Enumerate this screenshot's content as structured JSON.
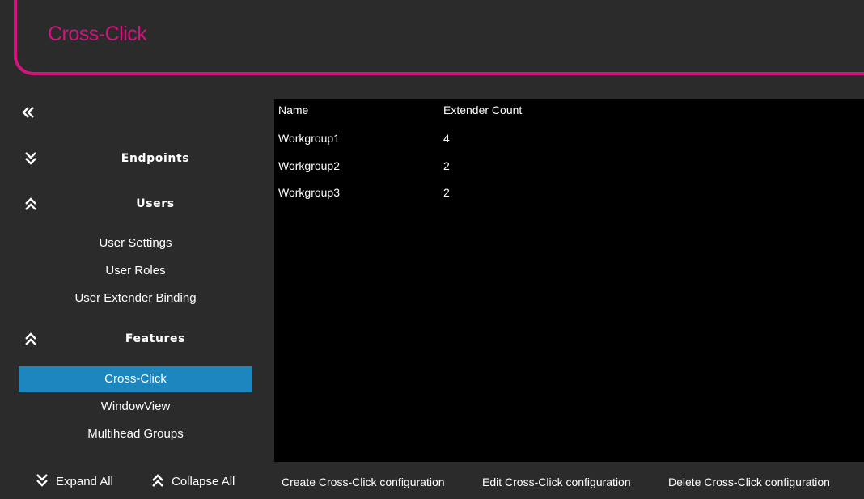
{
  "header": {
    "title": "Cross-Click"
  },
  "sidebar": {
    "collapse_icon": "double-chevron-left-icon",
    "sections": {
      "endpoints": {
        "label": "Endpoints",
        "state": "collapsed"
      },
      "users": {
        "label": "Users",
        "state": "expanded",
        "items": [
          "User Settings",
          "User Roles",
          "User Extender Binding"
        ]
      },
      "features": {
        "label": "Features",
        "state": "expanded",
        "items": [
          "Cross-Click",
          "WindowView",
          "Multihead Groups"
        ],
        "selected": "Cross-Click"
      }
    },
    "expand_all_label": "Expand All",
    "collapse_all_label": "Collapse All"
  },
  "table": {
    "columns": [
      "Name",
      "Extender Count"
    ],
    "rows": [
      {
        "name": "Workgroup1",
        "count": "4"
      },
      {
        "name": "Workgroup2",
        "count": "2"
      },
      {
        "name": "Workgroup3",
        "count": "2"
      }
    ]
  },
  "actions": {
    "create": "Create Cross-Click configuration",
    "edit": "Edit Cross-Click configuration",
    "delete": "Delete Cross-Click configuration"
  },
  "colors": {
    "accent": "#d3147d",
    "selection": "#1c87bf",
    "background": "#2b2b2b",
    "table_background": "#000000"
  }
}
